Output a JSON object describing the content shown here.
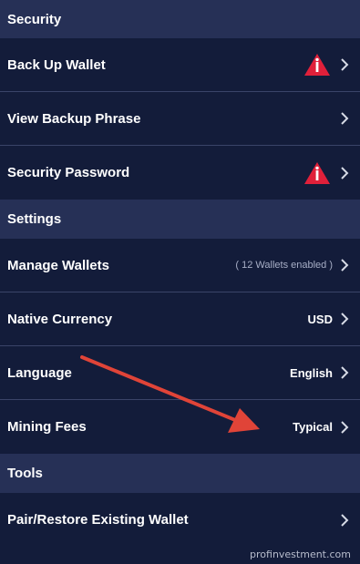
{
  "sections": {
    "security": {
      "title": "Security",
      "items": [
        {
          "label": "Back Up Wallet"
        },
        {
          "label": "View Backup Phrase"
        },
        {
          "label": "Security Password"
        }
      ]
    },
    "settings": {
      "title": "Settings",
      "items": [
        {
          "label": "Manage Wallets",
          "value": "( 12 Wallets enabled )"
        },
        {
          "label": "Native Currency",
          "value": "USD"
        },
        {
          "label": "Language",
          "value": "English"
        },
        {
          "label": "Mining Fees",
          "value": "Typical"
        }
      ]
    },
    "tools": {
      "title": "Tools",
      "items": [
        {
          "label": "Pair/Restore Existing Wallet"
        }
      ]
    }
  },
  "icons": {
    "warning": "warning-icon",
    "chevron": "chevron-right-icon"
  },
  "colors": {
    "background": "#131c3a",
    "section_header": "#263056",
    "divider": "#3a4468",
    "warning_red": "#e0203a",
    "annotation_arrow": "#e04438"
  },
  "watermark": "profinvestment.com"
}
